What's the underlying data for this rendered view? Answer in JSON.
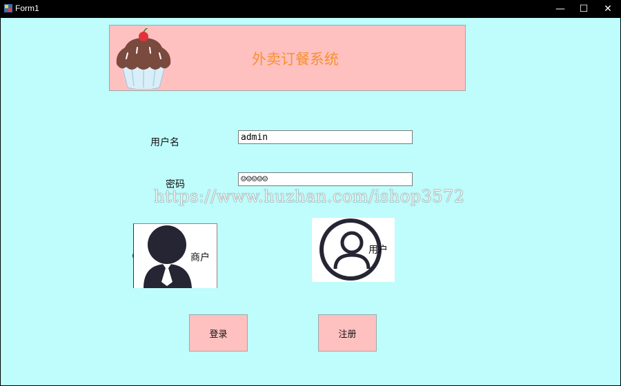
{
  "window": {
    "title": "Form1",
    "minimize_glyph": "—",
    "maximize_glyph": "☐",
    "close_glyph": "✕"
  },
  "banner": {
    "title": "外卖订餐系统",
    "icon": "cupcake-icon"
  },
  "form": {
    "username_label": "用户名",
    "username_value": "admin",
    "password_label": "密码",
    "password_value": "☺☺☺☺☺"
  },
  "roles": [
    {
      "label": "商户",
      "icon": "merchant-person-icon"
    },
    {
      "label": "用户",
      "icon": "user-circle-icon"
    }
  ],
  "buttons": {
    "login": "登录",
    "register": "注册"
  },
  "watermark": "https://www.huzhan.com/ishop3572",
  "colors": {
    "background": "#BFFCFC",
    "banner": "#FFC0C0",
    "banner_title": "#F7912E",
    "button": "#FFC0C0"
  }
}
